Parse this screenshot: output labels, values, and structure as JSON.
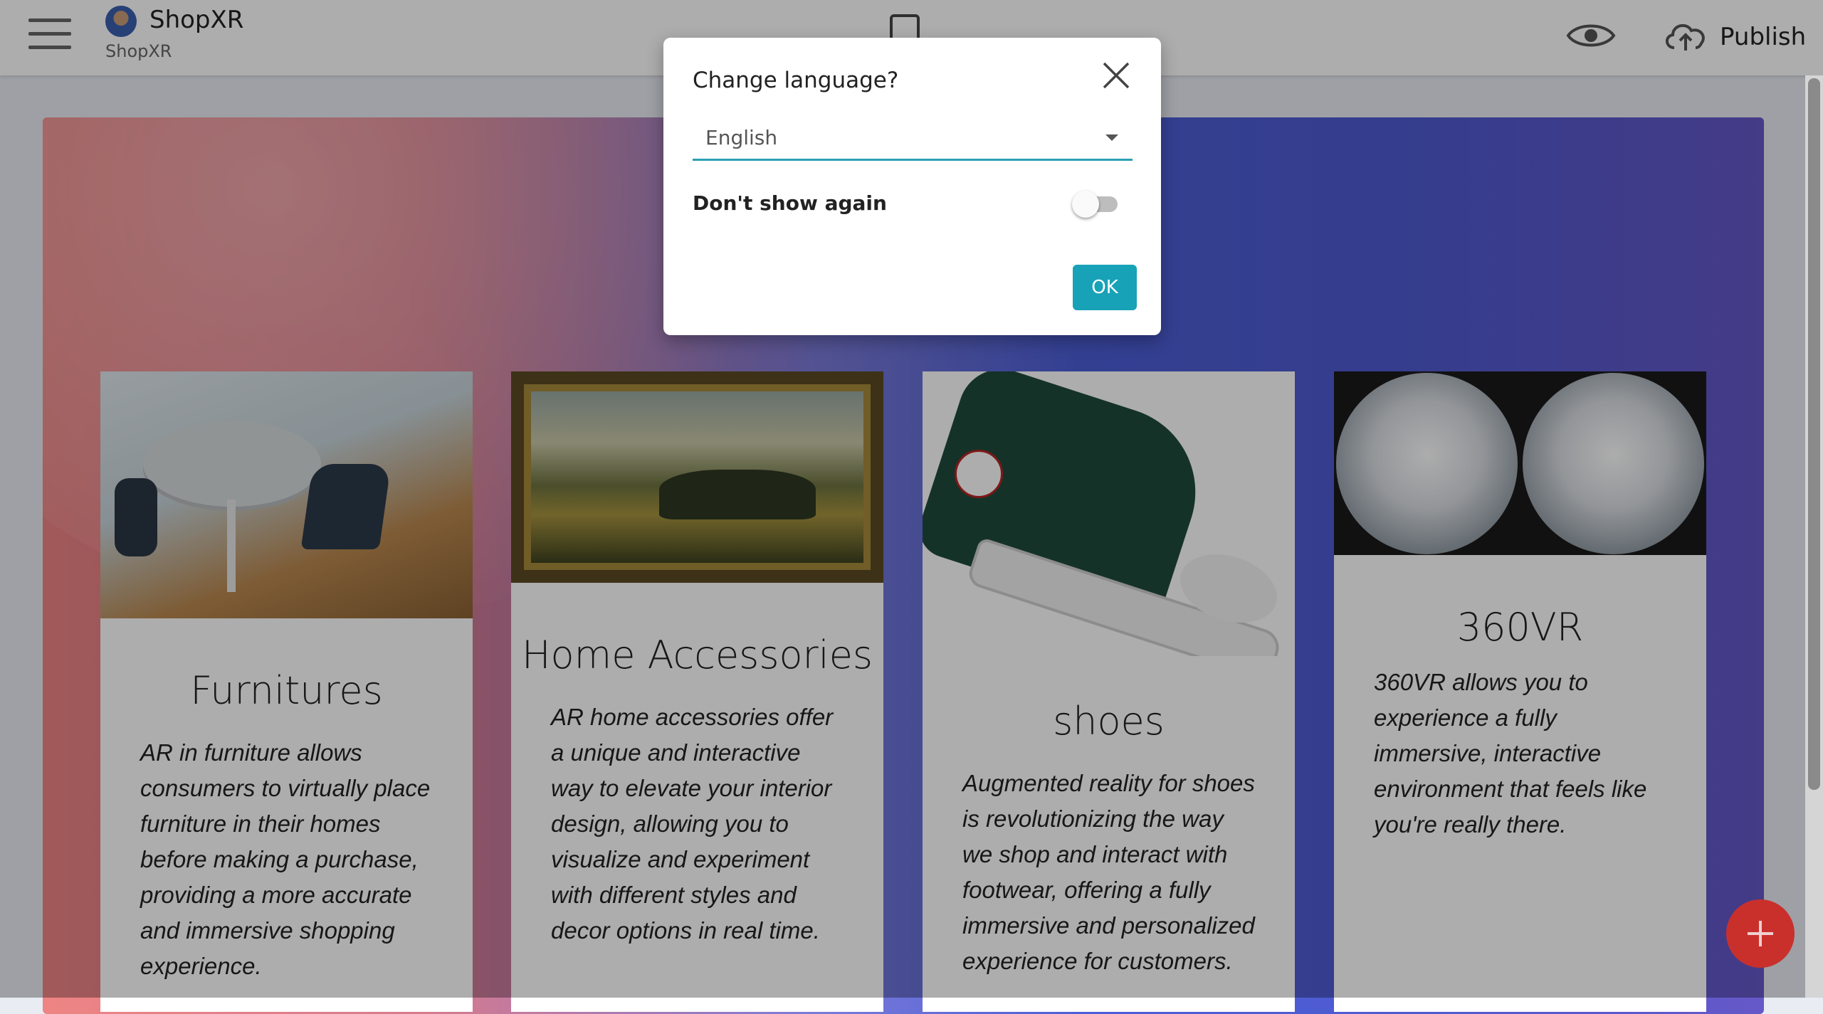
{
  "header": {
    "menu_icon": "hamburger-menu-icon",
    "app_title": "ShopXR",
    "app_subtitle": "ShopXR",
    "device_icon": "mobile-device-icon",
    "preview_icon": "eye-icon",
    "publish_icon": "cloud-upload-icon",
    "publish_label": "Publish"
  },
  "cards": [
    {
      "title": "Furnitures",
      "text": "AR in furniture allows consumers to virtually place furniture in their homes before making a purchase, providing a more accurate and immersive shopping experience."
    },
    {
      "title": "Home Accessories",
      "text": "AR home accessories offer a unique and interactive way to elevate your interior design, allowing you to visualize and experiment with different styles and decor options in real time."
    },
    {
      "title": "shoes",
      "text": "Augmented reality for shoes is revolutionizing the way we shop and interact with footwear, offering a fully immersive and personalized experience for customers."
    },
    {
      "title": "360VR",
      "text": "360VR allows you to experience a fully immersive, interactive environment that feels like you're really there."
    }
  ],
  "dialog": {
    "title": "Change language?",
    "close_icon": "close-icon",
    "language_selected": "English",
    "dont_show_label": "Don't show again",
    "dont_show_checked": false,
    "ok_label": "OK"
  },
  "fab": {
    "icon": "plus-icon"
  },
  "colors": {
    "accent": "#17a2b8",
    "fab": "#c9302c"
  }
}
